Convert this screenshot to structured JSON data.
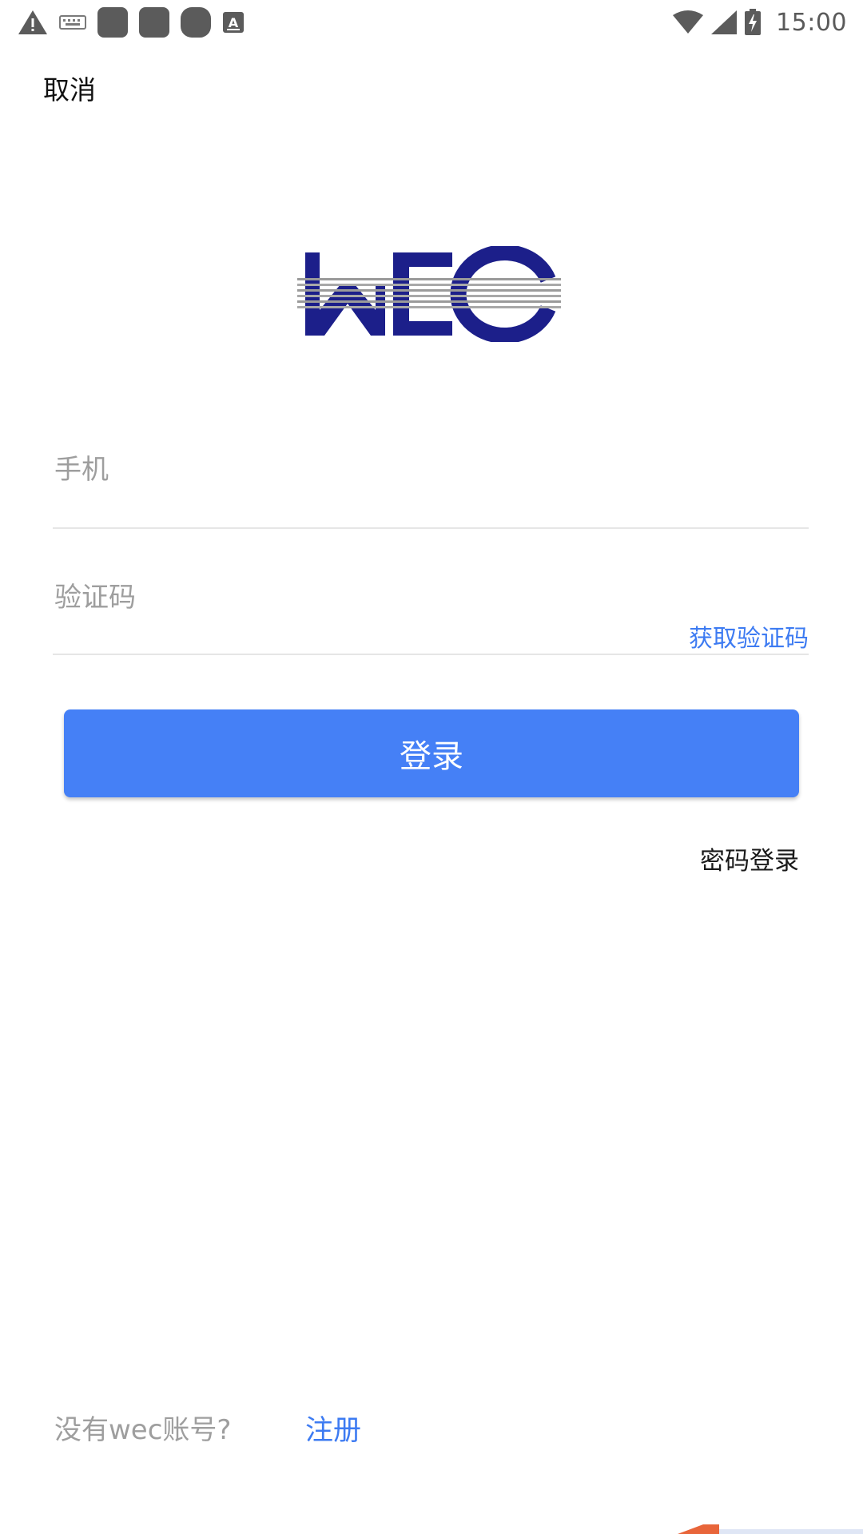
{
  "status_bar": {
    "time": "15:00",
    "left_icons": [
      "warning-icon",
      "keyboard-icon",
      "app-icon",
      "app-icon",
      "app-icon",
      "text-a-icon"
    ],
    "right_icons": [
      "wifi-icon",
      "cell-signal-icon",
      "battery-charging-icon"
    ]
  },
  "nav": {
    "cancel_label": "取消"
  },
  "logo": {
    "text": "WEC",
    "color": "#1c1f8a",
    "stripe_color": "#9a9a9a"
  },
  "form": {
    "phone_label": "手机",
    "code_label": "验证码",
    "get_code_label": "获取验证码"
  },
  "actions": {
    "login_label": "登录",
    "password_login_label": "密码登录"
  },
  "footer": {
    "no_account_text": "没有wec账号?",
    "register_label": "注册"
  },
  "colors": {
    "accent": "#4580f6",
    "link": "#3d7bf2",
    "placeholder": "#9e9e9e"
  }
}
